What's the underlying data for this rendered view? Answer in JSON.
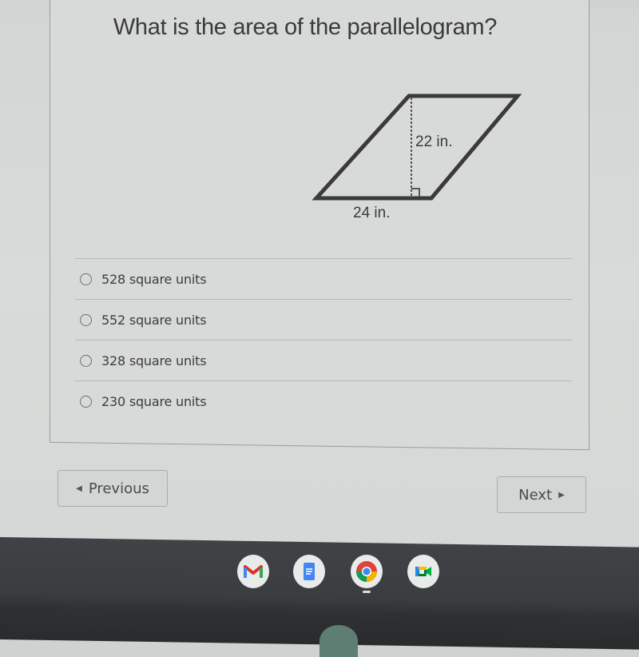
{
  "question": {
    "text": "What is the area of the parallelogram?",
    "figure": {
      "shape": "parallelogram",
      "height_label": "22 in.",
      "base_label": "24 in."
    }
  },
  "choices": [
    {
      "label": "528 square units",
      "selected": false
    },
    {
      "label": "552 square units",
      "selected": false
    },
    {
      "label": "328 square units",
      "selected": false
    },
    {
      "label": "230 square units",
      "selected": false
    }
  ],
  "navigation": {
    "previous_label": "Previous",
    "next_label": "Next",
    "previous_icon": "triangle-left-icon",
    "next_icon": "triangle-right-icon"
  },
  "shelf": {
    "apps": [
      {
        "name": "Gmail",
        "icon": "gmail-icon"
      },
      {
        "name": "Google Docs",
        "icon": "docs-icon"
      },
      {
        "name": "Chrome",
        "icon": "chrome-icon",
        "running": true
      },
      {
        "name": "Google Meet",
        "icon": "meet-icon"
      }
    ]
  }
}
